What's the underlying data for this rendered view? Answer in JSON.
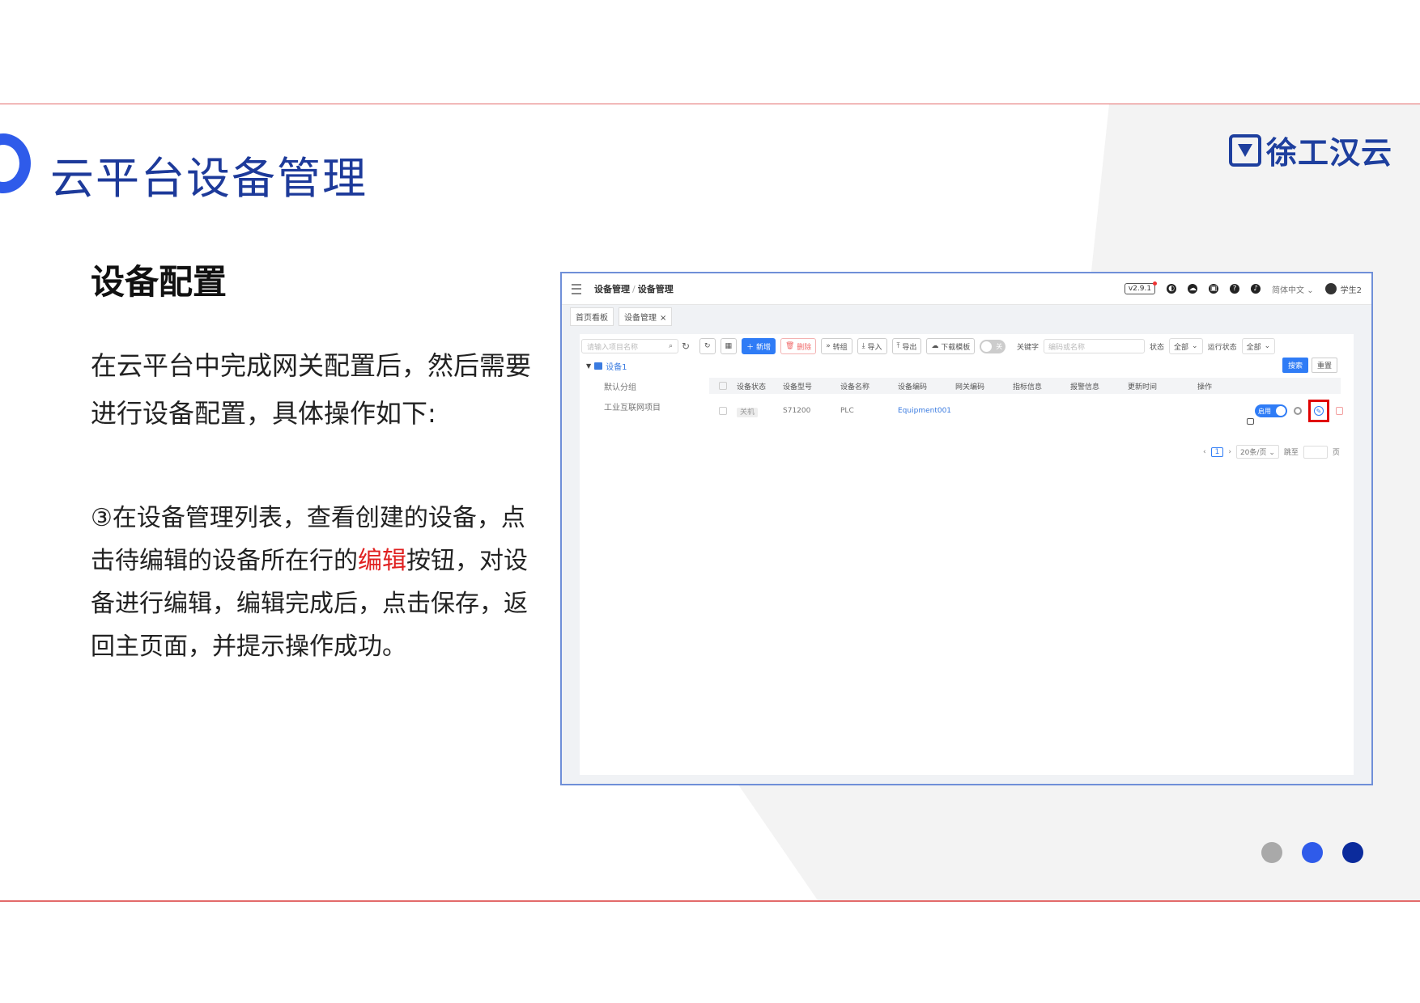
{
  "slide": {
    "title": "云平台设备管理",
    "logo_text": "徐工汉云",
    "section_title": "设备配置",
    "intro": "在云平台中完成网关配置后，然后需要进行设备配置，具体操作如下:",
    "step_before": "③在设备管理列表，查看创建的设备，点击待编辑的设备所在行的",
    "step_highlight": "编辑",
    "step_after": "按钮，对设备进行编辑，编辑完成后，点击保存，返回主页面，并提示操作成功。",
    "dots": [
      "#a9a9a9",
      "#2f5bea",
      "#0b2b9c"
    ],
    "accent": "#1d3a9a",
    "highlight_color": "#e02020"
  },
  "app": {
    "breadcrumb": {
      "parent": "设备管理",
      "current": "设备管理"
    },
    "version": "v2.9.1",
    "language": "简体中文",
    "username": "学生2",
    "tabs": [
      {
        "label": "首页看板"
      },
      {
        "label": "设备管理",
        "close": "×"
      }
    ],
    "tree_search_placeholder": "请输入项目名称",
    "tree": {
      "root": "设备1",
      "children": [
        "默认分组",
        "工业互联网项目"
      ]
    },
    "toolbar": {
      "add": "新增",
      "delete": "删除",
      "transfer": "转组",
      "import": "导入",
      "export": "导出",
      "template": "下载模板",
      "toggle_label": "关"
    },
    "filters": {
      "keyword_label": "关键字",
      "keyword_placeholder": "编码或名称",
      "status_label": "状态",
      "status_value": "全部",
      "run_status_label": "运行状态",
      "run_status_value": "全部",
      "search": "搜索",
      "reset": "重置"
    },
    "table": {
      "columns": [
        "设备状态",
        "设备型号",
        "设备名称",
        "设备编码",
        "网关编码",
        "指标信息",
        "报警信息",
        "更新时间",
        "操作"
      ],
      "rows": [
        {
          "status": "关机",
          "model": "S71200",
          "name": "PLC",
          "code": "Equipment001",
          "enable_label": "启用"
        }
      ]
    },
    "pager": {
      "current": "1",
      "page_size": "20条/页",
      "goto_label": "跳至",
      "page_suffix": "页"
    }
  }
}
